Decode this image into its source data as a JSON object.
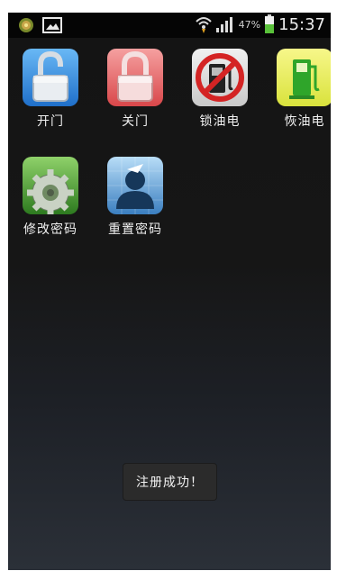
{
  "status_bar": {
    "time": "15:37",
    "battery_percent": "47%",
    "icons": [
      "app-notification-icon",
      "image-notification-icon",
      "wifi-icon",
      "signal-icon",
      "battery-icon"
    ]
  },
  "apps": [
    {
      "label": "开门",
      "icon": "unlocked-padlock-icon",
      "color": "#3d8fe0"
    },
    {
      "label": "关门",
      "icon": "locked-padlock-icon",
      "color": "#e86a6a"
    },
    {
      "label": "锁油电",
      "icon": "fuel-lock-icon",
      "color": "#d12a2a"
    },
    {
      "label": "恢油电",
      "icon": "fuel-pump-icon",
      "color": "#31a82e"
    },
    {
      "label": "修改密码",
      "icon": "settings-gear-icon",
      "color": "#3a8f2a"
    },
    {
      "label": "重置密码",
      "icon": "user-reset-icon",
      "color": "#3c7fc4"
    }
  ],
  "toast": {
    "text": "注册成功！"
  }
}
